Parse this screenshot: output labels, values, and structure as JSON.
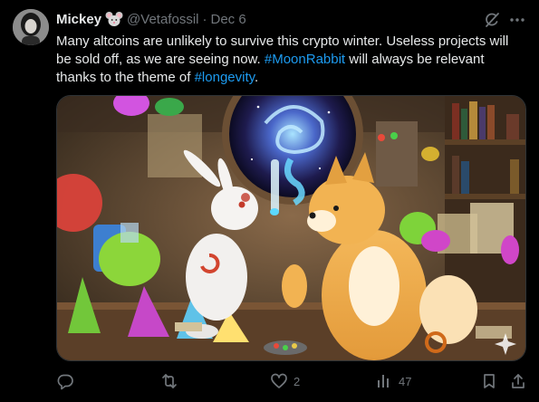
{
  "author": {
    "display_name": "Mickey",
    "name_emoji_icon": "mouse-face-icon",
    "handle": "@Vetafossil",
    "separator": "·",
    "date": "Dec 6"
  },
  "post": {
    "text_part1": "Many altcoins are unlikely to survive this crypto winter. Useless projects will be sold off, as we are seeing now. ",
    "hashtag1": "#MoonRabbit",
    "text_part2": " will always be relevant thanks to the theme of ",
    "hashtag2": "#longevity",
    "text_part3": "."
  },
  "media": {
    "description_icon": "illustration-image",
    "sparkle_icon": "sparkle-icon"
  },
  "actions": {
    "reply_icon": "reply-icon",
    "repost_icon": "repost-icon",
    "like_icon": "heart-icon",
    "like_count": "2",
    "views_icon": "views-icon",
    "views_count": "47",
    "bookmark_icon": "bookmark-icon",
    "share_icon": "share-icon"
  },
  "colors": {
    "background": "#000000",
    "text": "#e7e9ea",
    "muted": "#71767b",
    "link": "#1d9bf0"
  }
}
